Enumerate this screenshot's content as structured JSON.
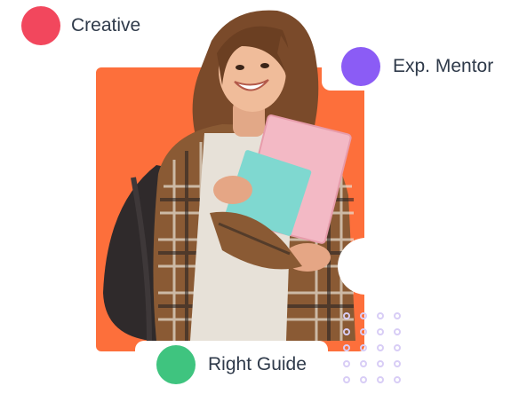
{
  "badges": {
    "creative": {
      "label": "Creative",
      "color": "#f2475d"
    },
    "mentor": {
      "label": "Exp. Mentor",
      "color": "#8b5cf5"
    },
    "guide": {
      "label": "Right Guide",
      "color": "#3fc47f"
    }
  },
  "panel_color": "#fd6f3b",
  "photo": {
    "subject": "student-holding-notebooks"
  }
}
